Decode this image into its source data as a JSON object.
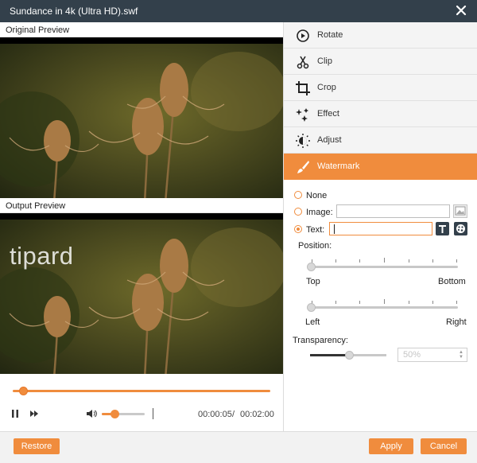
{
  "window": {
    "title": "Sundance in 4k (Ultra HD).swf",
    "close_icon": "close-icon"
  },
  "preview": {
    "original_label": "Original Preview",
    "output_label": "Output Preview",
    "watermark_text": "tipard"
  },
  "playback": {
    "progress": 0.04,
    "volume": 0.3,
    "current_time": "00:00:05",
    "time_separator": "/",
    "total_time": "00:02:00"
  },
  "menu": {
    "items": [
      {
        "label": "Rotate",
        "icon": "rotate-icon"
      },
      {
        "label": "Clip",
        "icon": "scissors-icon"
      },
      {
        "label": "Crop",
        "icon": "crop-icon"
      },
      {
        "label": "Effect",
        "icon": "sparkle-icon"
      },
      {
        "label": "Adjust",
        "icon": "adjust-icon"
      },
      {
        "label": "Watermark",
        "icon": "brush-icon",
        "active": true
      }
    ]
  },
  "watermark": {
    "none_label": "None",
    "image_label": "Image:",
    "text_label": "Text:",
    "selected": "Text",
    "image_value": "",
    "text_value": "",
    "position_label": "Position:",
    "top_label": "Top",
    "bottom_label": "Bottom",
    "left_label": "Left",
    "right_label": "Right",
    "vertical_position": 0,
    "horizontal_position": 0,
    "transparency_label": "Transparency:",
    "transparency_value": "50%",
    "transparency": 0.5
  },
  "footer": {
    "restore_label": "Restore",
    "apply_label": "Apply",
    "cancel_label": "Cancel"
  },
  "colors": {
    "accent": "#f08c3d",
    "titlebar": "#33404b"
  }
}
